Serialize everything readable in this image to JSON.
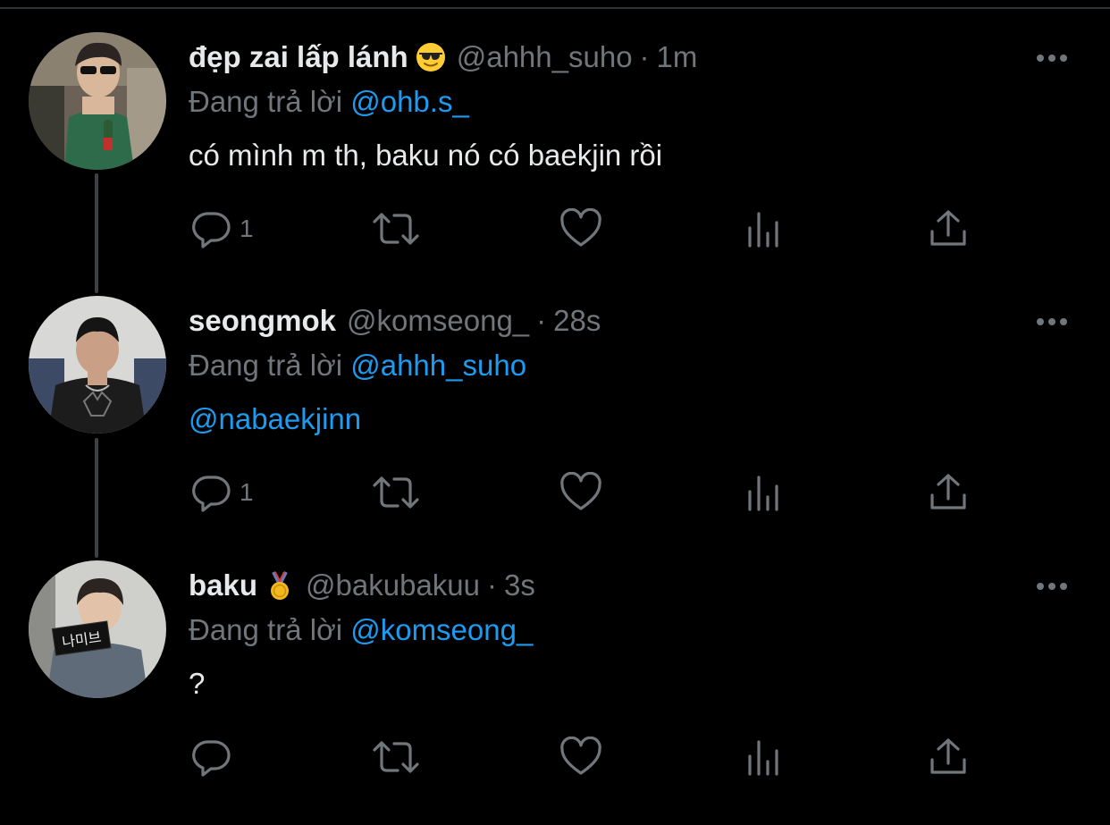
{
  "replying_prefix": "Đang trả lời",
  "tweets": [
    {
      "name": "đẹp zai lấp lánh",
      "name_emoji": "sunglasses-emoji",
      "handle": "@ahhh_suho",
      "separator": "·",
      "time": "1m",
      "replying_to": "@ohb.s_",
      "text": "có mình m th, baku nó có baekjin rồi",
      "reply_count": "1"
    },
    {
      "name": "seongmok",
      "handle": "@komseong_",
      "separator": "·",
      "time": "28s",
      "replying_to": "@ahhh_suho",
      "text": "@nabaekjinn",
      "reply_count": "1"
    },
    {
      "name": "baku",
      "name_emoji": "medal-emoji",
      "handle": "@bakubakuu",
      "separator": "·",
      "time": "3s",
      "replying_to": "@komseong_",
      "text": "?",
      "reply_count": ""
    }
  ],
  "avatar_sign_text": "나미브",
  "icons": {
    "more": "more-dots-icon",
    "reply": "reply-bubble-icon",
    "retweet": "retweet-icon",
    "like": "heart-icon",
    "views": "views-bar-chart-icon",
    "share": "share-upload-icon"
  },
  "colors": {
    "background": "#000000",
    "text": "#e7e9ea",
    "secondary": "#71767b",
    "link": "#1d9bf0",
    "thread_line": "#3e4144"
  }
}
